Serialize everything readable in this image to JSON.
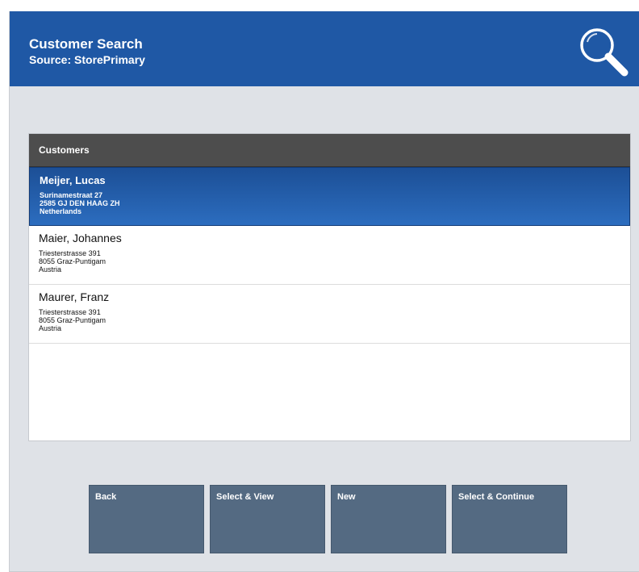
{
  "header": {
    "title": "Customer Search",
    "subtitle": "Source: StorePrimary",
    "search_icon": "search-icon"
  },
  "list": {
    "header_label": "Customers",
    "customers": [
      {
        "name": "Meijer, Lucas",
        "address": [
          "Surinamestraat 27",
          "2585 GJ DEN HAAG ZH",
          "Netherlands"
        ],
        "selected": true
      },
      {
        "name": "Maier, Johannes",
        "address": [
          "Triesterstrasse 391",
          "8055 Graz-Puntigam",
          "Austria"
        ],
        "selected": false
      },
      {
        "name": "Maurer, Franz",
        "address": [
          "Triesterstrasse 391",
          "8055 Graz-Puntigam",
          "Austria"
        ],
        "selected": false
      }
    ]
  },
  "buttons": {
    "back": "Back",
    "select_view": "Select & View",
    "new": "New",
    "select_continue": "Select & Continue"
  },
  "colors": {
    "header_bg": "#1f58a5",
    "selected_row": "#2a63b0",
    "button_bg": "#546a82",
    "list_header_bg": "#4d4d4d"
  }
}
